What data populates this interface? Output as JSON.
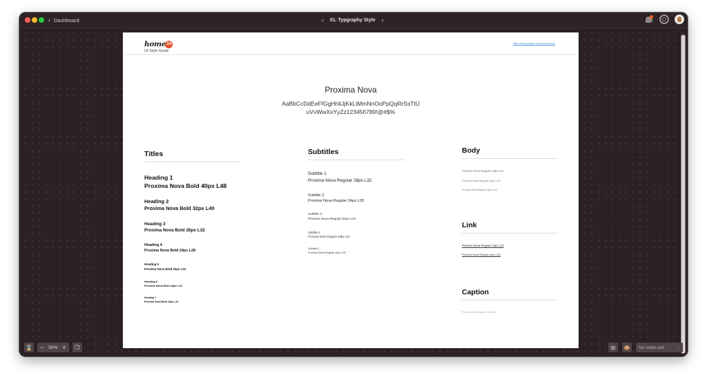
{
  "window": {
    "back_label": "Dashboard",
    "screen_title": "01. Typgraphy Style",
    "prev_icon": "‹",
    "next_icon": "›",
    "back_icon": "‹"
  },
  "header": {
    "logo_word": "home",
    "logo_badge": "24",
    "logo_subtitle": "UI Style Guide",
    "link": "https://fonts.google.com/proxima-nova"
  },
  "font_showcase": {
    "name": "Proxima Nova",
    "alphabet_line1": "AaBbCcDdEeFfGgHhIiJjKkLlMmNnOoPpQqRrSsTtU",
    "alphabet_line2": "uVvWwXxYyZz123456789!@#$%"
  },
  "titles": {
    "heading": "Titles",
    "items": [
      {
        "label": "Heading 1",
        "spec": "Proxima Nova Bold 40px L48"
      },
      {
        "label": "Heading 2",
        "spec": "Proxima Nova Bold 32px L40"
      },
      {
        "label": "Heading 3",
        "spec": "Proxima Nova Bold 28px L32"
      },
      {
        "label": "Heading 4",
        "spec": "Proxima Nova Bold 24px L28"
      },
      {
        "label": "Heading 5",
        "spec": "Proxima Nova Bold 20px L24"
      },
      {
        "label": "Heading 6",
        "spec": "Proxima Nova Bold 18px L22"
      },
      {
        "label": "Heading 7",
        "spec": "Proxima Nova Bold 16px L20"
      }
    ]
  },
  "subtitles": {
    "heading": "Subtitles",
    "items": [
      {
        "label": "Subtitle 1",
        "spec": "Proxima Nova Regular 28px L32"
      },
      {
        "label": "Subtitle 2",
        "spec": "Proxima Nova Regular 24px L28"
      },
      {
        "label": "Subtitle 3",
        "spec": "Proxima Nova Regular 20px L24"
      },
      {
        "label": "Subtitle 4",
        "spec": "Proxima Nova Regular 18px L22"
      },
      {
        "label": "Subtitle 5",
        "spec": "Proxima Nova Regular 16px L20"
      }
    ]
  },
  "body": {
    "heading": "Body",
    "items": [
      "Proxima Nova Regular 18px L24",
      "Proxima Nova Regular 16px L20",
      "Proxima Nova Regular 14px L18"
    ]
  },
  "link": {
    "heading": "Link",
    "items": [
      "Proxima Nova Regular 18px L24",
      "Proxima Nova Regular 16px L20"
    ]
  },
  "caption": {
    "heading": "Caption",
    "items": [
      "Proxima Nova Regular 14px L20"
    ]
  },
  "toolbar": {
    "zoom_level": "50%",
    "zoom_out": "−",
    "zoom_in": "+",
    "notes_placeholder": "No notes yet",
    "notes_caret": "⌄"
  },
  "colors": {
    "canvas_bg": "#2b2123",
    "logo_accent": "#e4512c",
    "notification_dot": "#f2622a",
    "link_color": "#4a90d9"
  }
}
